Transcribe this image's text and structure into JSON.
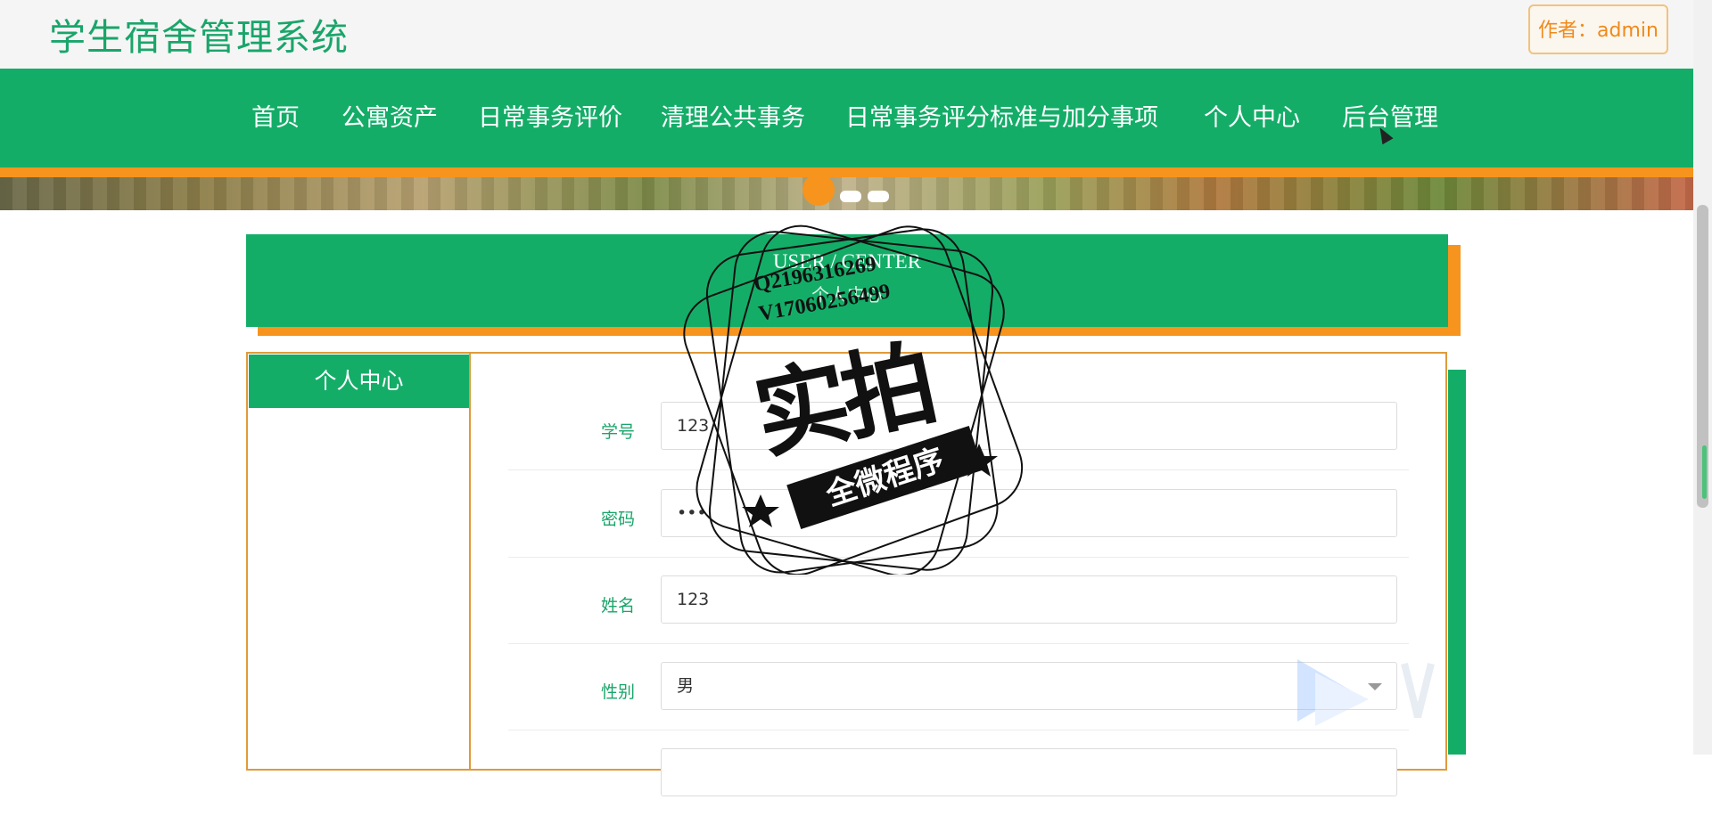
{
  "site": {
    "title": "学生宿舍管理系统",
    "author_label": "作者：admin"
  },
  "nav": {
    "items": [
      {
        "label": "首页"
      },
      {
        "label": "公寓资产"
      },
      {
        "label": "日常事务评价"
      },
      {
        "label": "清理公共事务"
      },
      {
        "label": "日常事务评分标准与加分事项"
      },
      {
        "label": "个人中心"
      },
      {
        "label": "后台管理"
      }
    ]
  },
  "banner": {
    "carousel_dots": 3,
    "active_dot": 1
  },
  "page_header": {
    "english": "USER / CENTER",
    "chinese": "个人中心"
  },
  "sidebar": {
    "title": "个人中心"
  },
  "form": {
    "fields": [
      {
        "label": "学号",
        "value": "123",
        "type": "text"
      },
      {
        "label": "密码",
        "value": "•••",
        "type": "password"
      },
      {
        "label": "姓名",
        "value": "123",
        "type": "text"
      },
      {
        "label": "性别",
        "value": "男",
        "type": "select"
      }
    ]
  },
  "watermark": {
    "line1": "Q2196316269",
    "line2": "V17060256499",
    "main": "实拍",
    "ribbon": "全微程序"
  },
  "colors": {
    "primary": "#14ad68",
    "accent": "#f7941d",
    "author": "#f08a1a"
  }
}
